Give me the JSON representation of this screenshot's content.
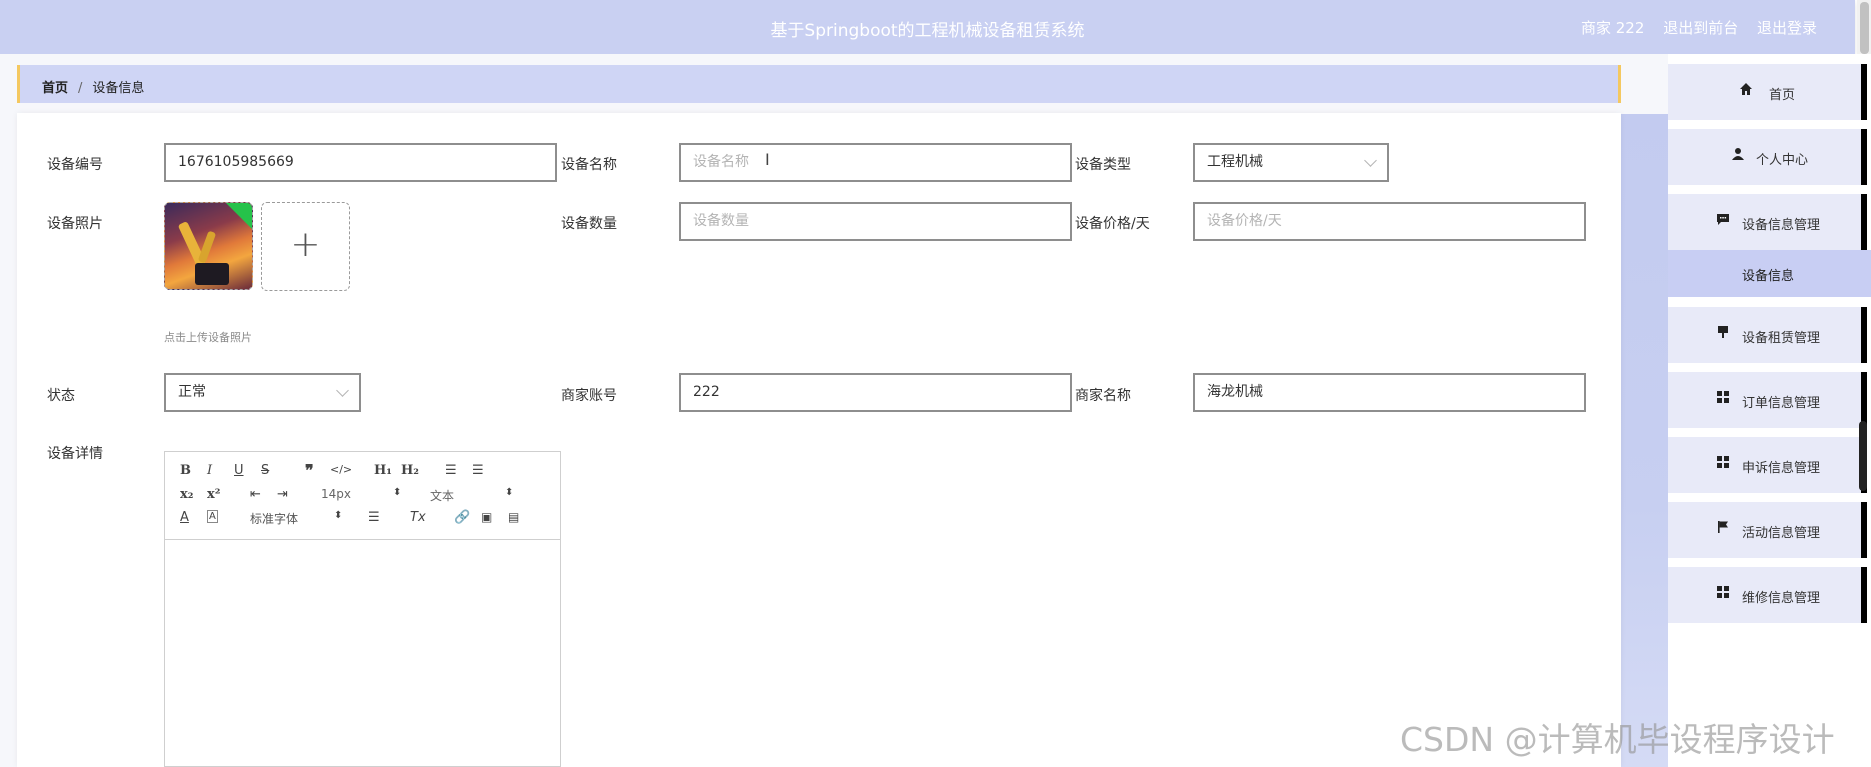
{
  "header": {
    "title": "基于Springboot的工程机械设备租赁系统",
    "user": "商家 222",
    "to_front": "退出到前台",
    "logout": "退出登录"
  },
  "breadcrumb": {
    "home": "首页",
    "separator": "/",
    "current": "设备信息"
  },
  "form": {
    "code_label": "设备编号",
    "code_value": "1676105985669",
    "name_label": "设备名称",
    "name_placeholder": "设备名称",
    "type_label": "设备类型",
    "type_value": "工程机械",
    "photo_label": "设备照片",
    "photo_hint": "点击上传设备照片",
    "qty_label": "设备数量",
    "qty_placeholder": "设备数量",
    "price_label": "设备价格/天",
    "price_placeholder": "设备价格/天",
    "status_label": "状态",
    "status_value": "正常",
    "merchant_account_label": "商家账号",
    "merchant_account_value": "222",
    "merchant_name_label": "商家名称",
    "merchant_name_value": "海龙机械",
    "detail_label": "设备详情"
  },
  "editor": {
    "font_size": "14px",
    "header_select": "文本",
    "font_family": "标准字体"
  },
  "sidebar": {
    "items": [
      {
        "label": "首页",
        "icon": "home-icon"
      },
      {
        "label": "个人中心",
        "icon": "user-icon"
      },
      {
        "label": "设备信息管理",
        "icon": "chat-icon"
      },
      {
        "label": "设备租赁管理",
        "icon": "brush-icon"
      },
      {
        "label": "订单信息管理",
        "icon": "grid-icon"
      },
      {
        "label": "申诉信息管理",
        "icon": "grid-icon"
      },
      {
        "label": "活动信息管理",
        "icon": "flag-icon"
      },
      {
        "label": "维修信息管理",
        "icon": "grid-icon"
      }
    ],
    "subitem": "设备信息"
  },
  "watermark": "CSDN @计算机毕设程序设计",
  "colors": {
    "header_bg": "#c9d0f2",
    "breadcrumb_bg": "#cfd5f5",
    "accent_border": "#f4c860",
    "menu_bg": "#e8eaf8",
    "submenu_bg": "#c8cef3"
  }
}
